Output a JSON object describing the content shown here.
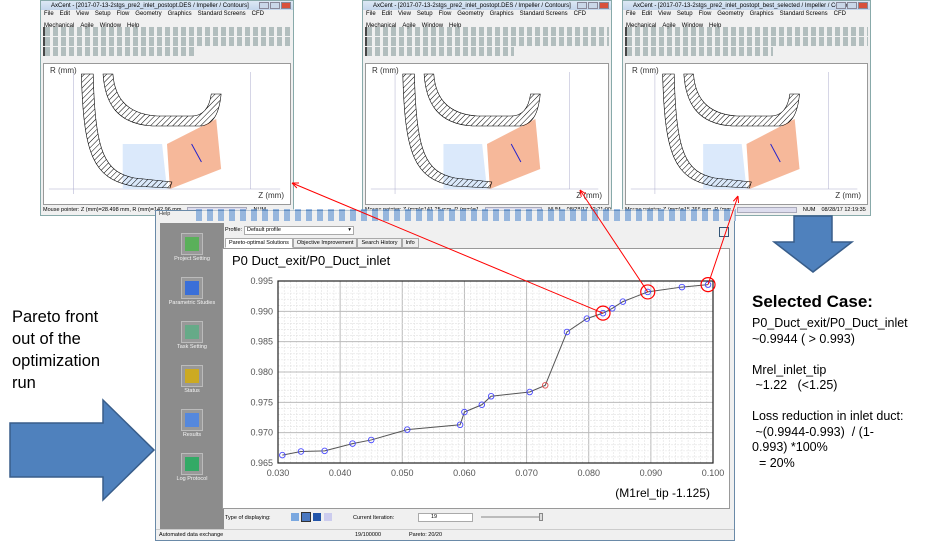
{
  "windows": [
    {
      "title": "AxCent - [2017-07-13-2stgs_pre2_inlet_postopt.DES / Impeller / Contours]",
      "status": "Mouse pointer: Z (mm)=28.498 mm, R (mm)=142.96 mm",
      "num": "NUM",
      "time": ""
    },
    {
      "title": "AxCent - [2017-07-13-2stgs_pre2_inlet_postopt.DES / Impeller / Contours]",
      "status": "Mouse pointer: Z (mm)=141.25 mm, R (mm)=1",
      "num": "NUM",
      "time": "08/28/17  12:21:00"
    },
    {
      "title": "AxCent - [2017-07-13-2stgs_pre2_inlet_postopt_best_selected / Impeller / Contours]",
      "status": "Mouse pointer: Z (mm)=15.766 mm, R (mm",
      "num": "NUM",
      "time": "08/28/17  12:19:35"
    }
  ],
  "menu": [
    "File",
    "Edit",
    "View",
    "Setup",
    "Flow",
    "Geometry",
    "Graphics",
    "Standard Screens",
    "CFD",
    "Mechanical",
    "Agile",
    "Window",
    "Help"
  ],
  "plot_labels": {
    "r": "R (mm)",
    "z": "Z (mm)"
  },
  "main": {
    "help": "Help",
    "sidebar": [
      "Project Setting",
      "Parametric Studies",
      "Task Setting",
      "Status",
      "Results",
      "Log Protocol"
    ],
    "profile_label": "Profile:",
    "profile_value": "Default profile",
    "tabs": [
      "Pareto-optimal Solutions",
      "Objective Improvement",
      "Search History",
      "Info"
    ],
    "type_label": "Type of displaying:",
    "iter_label": "Current Iteration:",
    "iter_value": "19",
    "status_left": "Automated data exchange",
    "status_count": "19/100000",
    "status_pareto": "Pareto: 20/20"
  },
  "chart_data": {
    "type": "line",
    "title": "P0  Duct_exit/P0_Duct_inlet",
    "xlabel": "(M1rel_tip -1.125)",
    "xlim": [
      0.03,
      0.1
    ],
    "ylim": [
      0.965,
      0.995
    ],
    "xticks": [
      "0.030",
      "0.040",
      "0.050",
      "0.060",
      "0.070",
      "0.080",
      "0.090",
      "0.100"
    ],
    "yticks": [
      "0.965",
      "0.970",
      "0.975",
      "0.980",
      "0.985",
      "0.990",
      "0.995"
    ],
    "grid": true,
    "x": [
      0.0307,
      0.0337,
      0.0375,
      0.042,
      0.045,
      0.0508,
      0.0593,
      0.06,
      0.0628,
      0.0643,
      0.0705,
      0.073,
      0.0765,
      0.0797,
      0.0823,
      0.0838,
      0.0855,
      0.0895,
      0.095,
      0.0992
    ],
    "y": [
      0.9663,
      0.9669,
      0.967,
      0.9682,
      0.9688,
      0.9705,
      0.9713,
      0.9734,
      0.9746,
      0.976,
      0.9767,
      0.9778,
      0.9866,
      0.9888,
      0.9897,
      0.9905,
      0.9916,
      0.9932,
      0.994,
      0.9944
    ],
    "highlight_index": 11,
    "circled_indices": [
      14,
      17,
      19
    ],
    "colors": {
      "point": "#4a4aff",
      "highlight": "#e05050",
      "line": "#555555",
      "callout": "#ff0000"
    }
  },
  "left_text": "Pareto front out of the optimization run",
  "right": {
    "heading": "Selected Case:",
    "lines": [
      "P0_Duct_exit/P0_Duct_inlet",
      "~0.9944 ( > 0.993)",
      "",
      "Mrel_inlet_tip",
      " ~1.22   (<1.25)",
      "",
      "Loss reduction in inlet duct:",
      " ~(0.9944-0.993)  / (1-",
      "0.993) *100%",
      "  = 20%"
    ]
  },
  "arrow_color": "#4f81bd"
}
